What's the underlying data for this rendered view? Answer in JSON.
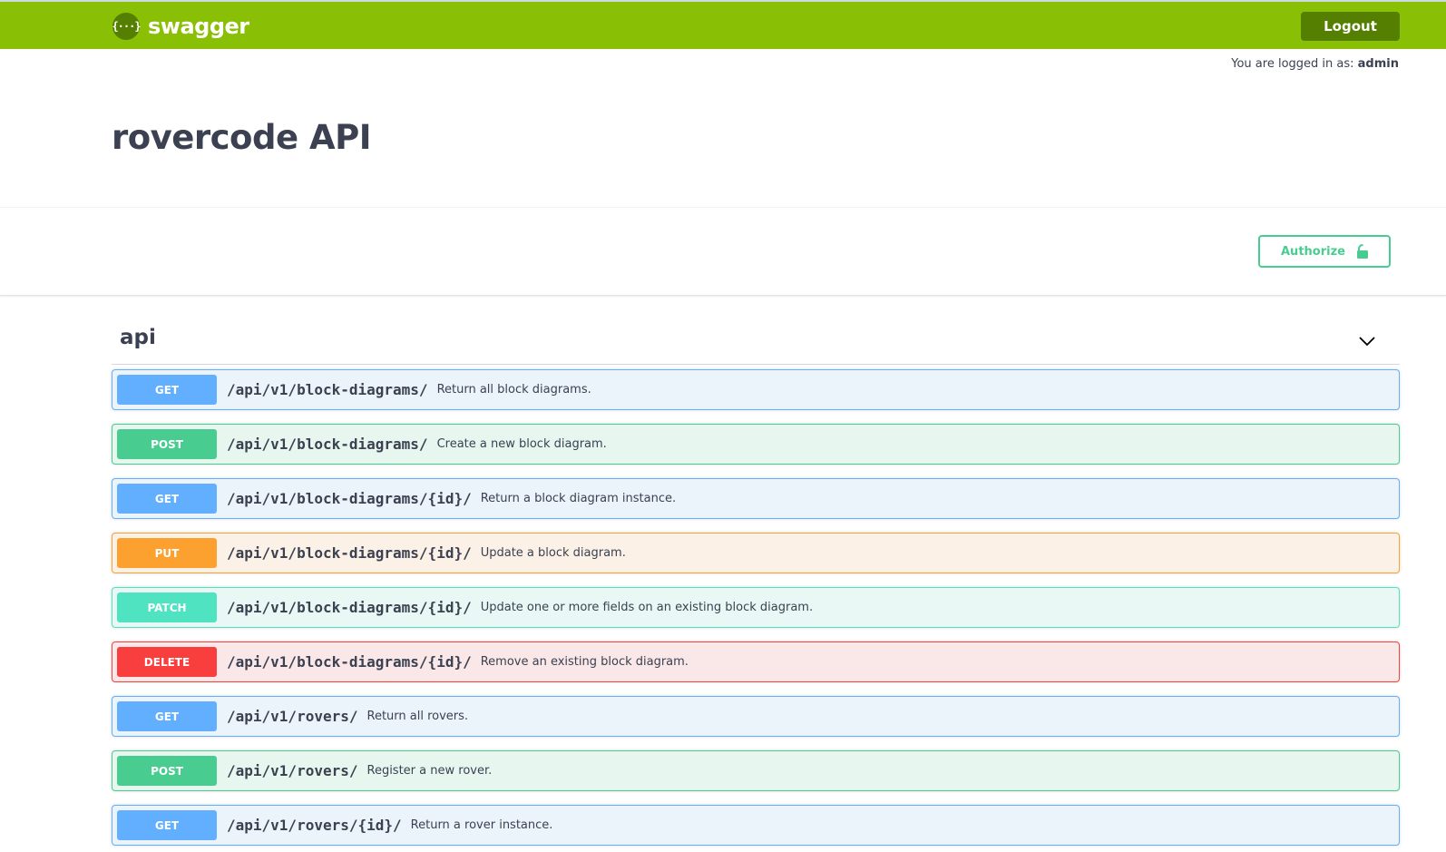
{
  "topbar": {
    "logo_glyph": "{···}",
    "brand_name": "swagger",
    "logout_label": "Logout",
    "color": "#89bf04"
  },
  "login": {
    "prefix": "You are logged in as:",
    "user": "admin"
  },
  "page": {
    "title": "rovercode API"
  },
  "auth": {
    "authorize_label": "Authorize",
    "icon": "lock-icon"
  },
  "tag": {
    "name": "api",
    "icon": "chevron-down-icon"
  },
  "operations": [
    {
      "method": "GET",
      "path": "/api/v1/block-diagrams/",
      "description": "Return all block diagrams."
    },
    {
      "method": "POST",
      "path": "/api/v1/block-diagrams/",
      "description": "Create a new block diagram."
    },
    {
      "method": "GET",
      "path": "/api/v1/block-diagrams/{id}/",
      "description": "Return a block diagram instance."
    },
    {
      "method": "PUT",
      "path": "/api/v1/block-diagrams/{id}/",
      "description": "Update a block diagram."
    },
    {
      "method": "PATCH",
      "path": "/api/v1/block-diagrams/{id}/",
      "description": "Update one or more fields on an existing block diagram."
    },
    {
      "method": "DELETE",
      "path": "/api/v1/block-diagrams/{id}/",
      "description": "Remove an existing block diagram."
    },
    {
      "method": "GET",
      "path": "/api/v1/rovers/",
      "description": "Return all rovers."
    },
    {
      "method": "POST",
      "path": "/api/v1/rovers/",
      "description": "Register a new rover."
    },
    {
      "method": "GET",
      "path": "/api/v1/rovers/{id}/",
      "description": "Return a rover instance."
    }
  ],
  "method_colors": {
    "GET": "#61affe",
    "POST": "#49cc90",
    "PUT": "#fca130",
    "PATCH": "#50e3c2",
    "DELETE": "#f93e3e"
  }
}
